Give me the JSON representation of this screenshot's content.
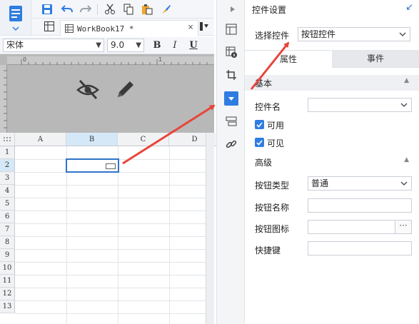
{
  "toolbar": {
    "icons": [
      "save-icon",
      "undo-icon",
      "redo-icon",
      "cut-icon",
      "copy-icon",
      "paste-icon",
      "format-brush-icon"
    ]
  },
  "workbook_tab": {
    "label": "WorkBook17 *",
    "close": "×"
  },
  "font_bar": {
    "font_name": "宋体",
    "font_size": "9.0",
    "bold": "B",
    "italic": "I",
    "underline": "U"
  },
  "ruler": {
    "marks": [
      "0",
      "1"
    ]
  },
  "grid": {
    "columns": [
      "A",
      "B",
      "C",
      "D"
    ],
    "rows": [
      "1",
      "2",
      "3",
      "4",
      "5",
      "6",
      "7",
      "8",
      "9",
      "10",
      "11",
      "12",
      "13"
    ],
    "selected_cell": "B2"
  },
  "panel": {
    "title": "控件设置",
    "select_control_label": "选择控件",
    "select_control_value": "按钮控件",
    "tabs": [
      {
        "label": "属性",
        "active": true
      },
      {
        "label": "事件",
        "active": false
      }
    ],
    "basic_section": "基本",
    "widget_name_label": "控件名",
    "widget_name_value": "",
    "enabled_label": "可用",
    "visible_label": "可见",
    "advanced_section": "高级",
    "button_type_label": "按钮类型",
    "button_type_value": "普通",
    "button_name_label": "按钮名称",
    "button_name_value": "",
    "button_icon_label": "按钮图标",
    "button_icon_value": "",
    "browse_label": "···",
    "hotkey_label": "快捷键",
    "hotkey_value": ""
  },
  "colors": {
    "accent": "#2f7de1",
    "arrow": "#e8443a",
    "preview_bg": "#b8b8b8",
    "selected_header": "#d5e8f7"
  }
}
